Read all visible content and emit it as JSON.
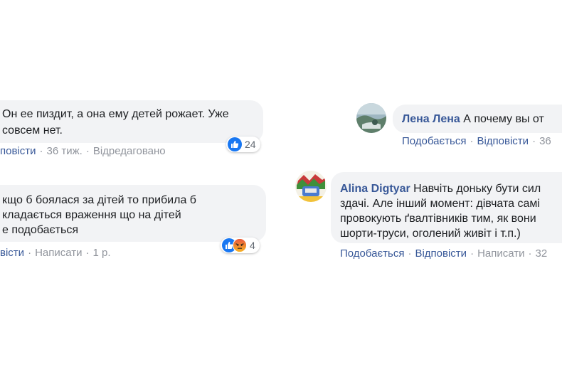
{
  "left": {
    "comment1": {
      "line1": "Он ее пиздит, а она ему детей рожает. Уже",
      "line2": "совсем нет.",
      "actions": {
        "reply": "повісти",
        "time": "36 тиж.",
        "edited": "Відредаговано"
      },
      "reactions": {
        "count": "24"
      }
    },
    "comment2": {
      "line1": "кщо б боялася за дітей то прибила б",
      "line2": "кладається враження що на дітей",
      "line3": "е подобається",
      "actions": {
        "reply": "вісти",
        "write": "Написати",
        "time": "1 р."
      },
      "reactions": {
        "count": "4"
      }
    }
  },
  "right": {
    "comment1": {
      "author": "Лена Лена",
      "text": " А почему вы от",
      "actions": {
        "like": "Подобається",
        "reply": "Відповісти",
        "time": "36"
      }
    },
    "comment2": {
      "author": "Alina Digtyar",
      "line1": " Навчіть доньку бути сил",
      "line2": "здачі. Але інший момент: дівчата самі",
      "line3": "провокують ґвалтівників тим, як вони",
      "line4": "шорти-труси, оголений живіт і т.п.)",
      "actions": {
        "like": "Подобається",
        "reply": "Відповісти",
        "write": "Написати",
        "time": "32"
      }
    }
  },
  "icons": {
    "reaction_like": "thumbs-up-icon",
    "reaction_angry": "angry-face-icon"
  },
  "colors": {
    "link": "#385898",
    "bubble": "#f2f3f5",
    "meta": "#90949c",
    "like_blue": "#1877f2",
    "angry_orange": "#f7b125"
  }
}
